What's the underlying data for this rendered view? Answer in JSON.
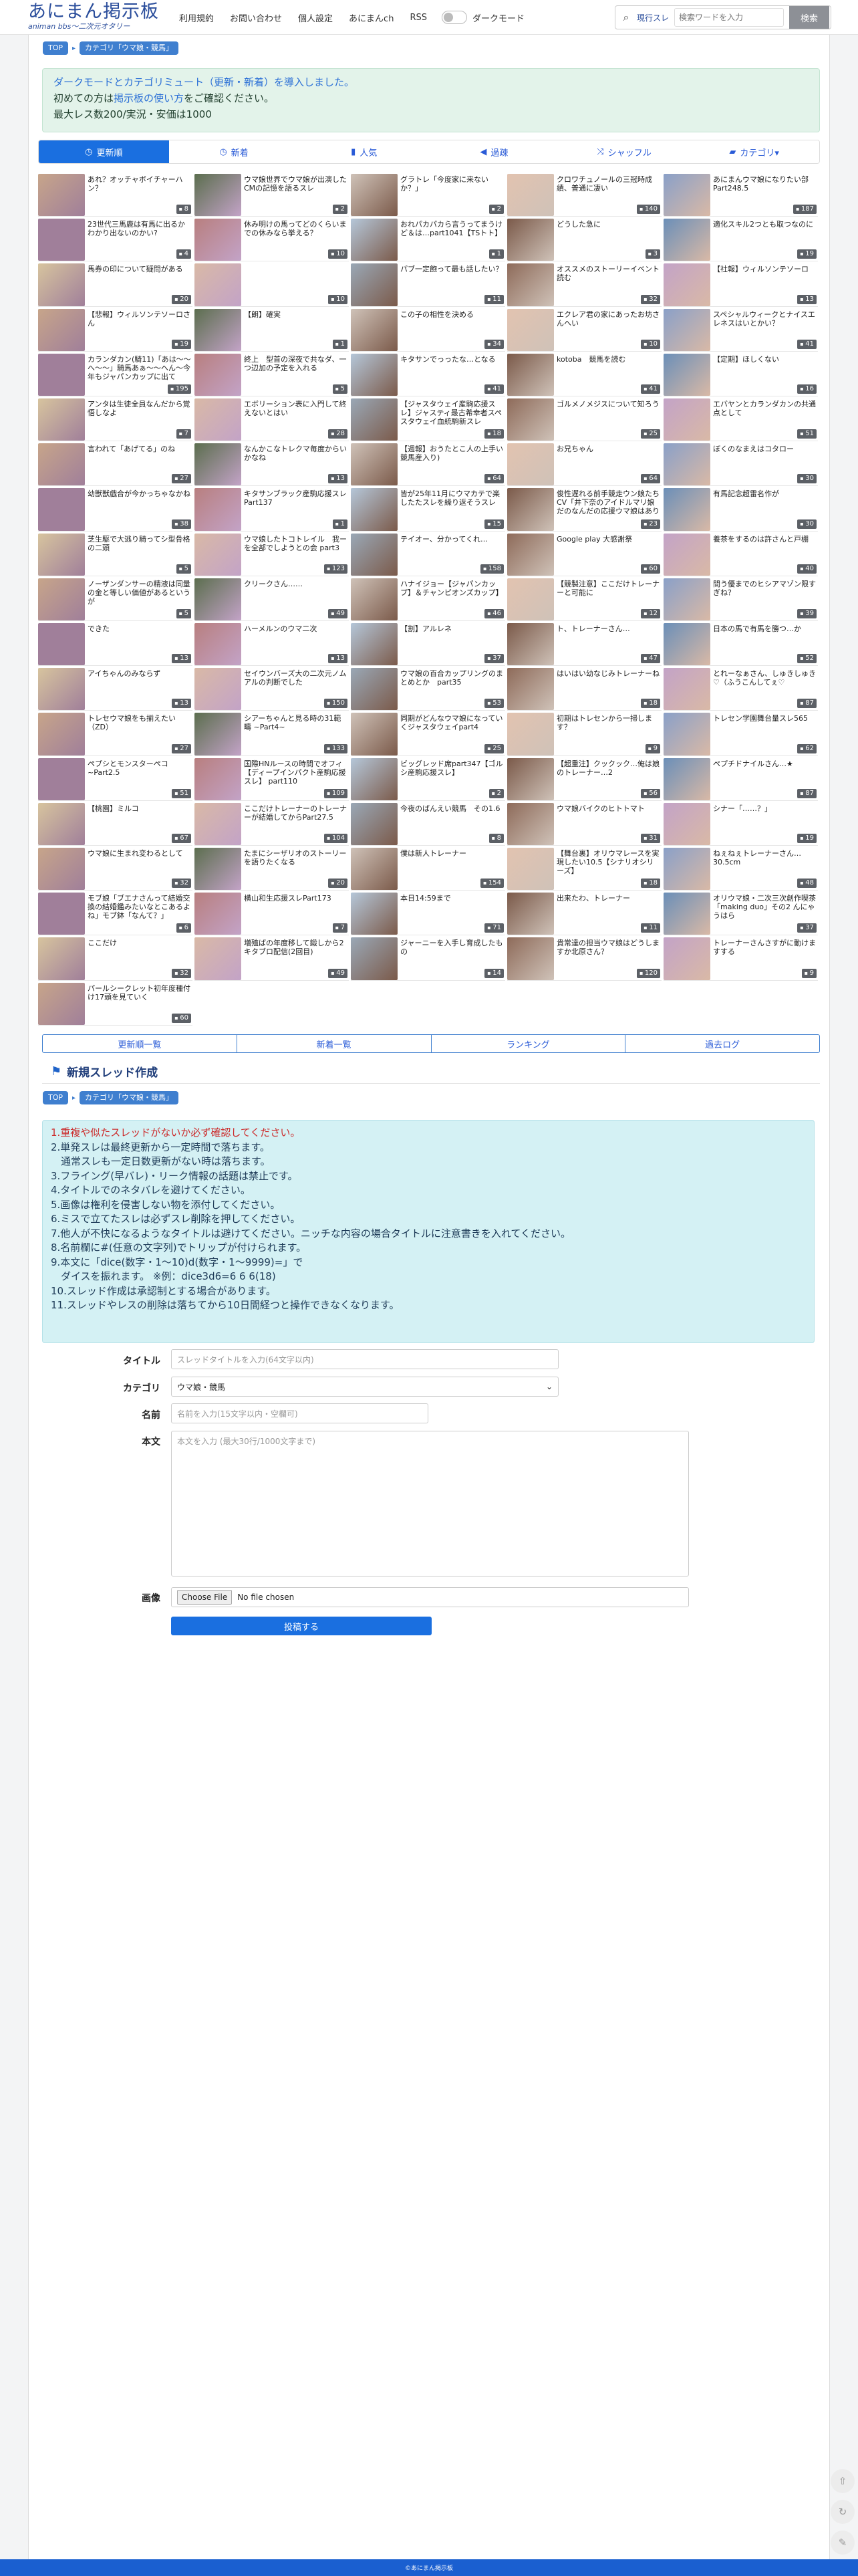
{
  "header": {
    "logo_title": "あにまん掲示板",
    "logo_subtitle": "animan bbs〜二次元オタリー",
    "nav": [
      "利用規約",
      "お問い合わせ",
      "個人設定",
      "あにまんch",
      "RSS"
    ],
    "dark_mode_label": "ダークモード",
    "search_scope": "現行スレ",
    "search_placeholder": "検索ワードを入力",
    "search_button": "検索"
  },
  "breadcrumb": [
    "TOP",
    "カテゴリ「ウマ娘・競馬」"
  ],
  "notice": {
    "line1": "ダークモードとカテゴリミュート（更新・新着）を導入しました。",
    "line2_pre": "初めての方は",
    "line2_link": "掲示板の使い方",
    "line2_post": "をご確認ください。",
    "line3": "最大レス数200/実況・安価は1000"
  },
  "tabs": [
    "更新順",
    "新着",
    "人気",
    "過疎",
    "シャッフル",
    "カテゴリ▾"
  ],
  "tab_icons": [
    "clock-icon",
    "clock-icon",
    "bar-chart-icon",
    "speaker-icon",
    "shuffle-icon",
    "folder-icon"
  ],
  "threads": [
    {
      "title": "あれ？オッチャボイチャーハン？",
      "count": "8"
    },
    {
      "title": "ウマ娘世界でウマ娘が出演したCMの記憶を語るスレ",
      "count": "2"
    },
    {
      "title": "グラトレ「今度家に来ないか？」",
      "count": "2"
    },
    {
      "title": "クロワチュノールの三冠時成績、普通に凄い",
      "count": "140"
    },
    {
      "title": "あにまんウマ娘になりたい部Part248.5",
      "count": "187"
    },
    {
      "title": "23世代三馬鹿は有馬に出るかわかり出ないのかい?",
      "count": "4"
    },
    {
      "title": "休み明けの馬ってどのくらいまでの休みなら挙える？",
      "count": "10"
    },
    {
      "title": "おれパカパカら言うってまうけど＆は…part1041【TSトト】",
      "count": "1"
    },
    {
      "title": "どうした急に",
      "count": "3"
    },
    {
      "title": "適化スキル2つとも取つなのに",
      "count": "19"
    },
    {
      "title": "馬券の印について疑問がある",
      "count": "20"
    },
    {
      "title": "",
      "count": "10"
    },
    {
      "title": "パブ一定飽って最も話したい？",
      "count": "11"
    },
    {
      "title": "オススメのストーリーイベント読む",
      "count": "32"
    },
    {
      "title": "【社報】ウィルソンテソーロ",
      "count": "13"
    },
    {
      "title": "【悲報】ウィルソンテソーロさん",
      "count": "19"
    },
    {
      "title": "【朗】確実",
      "count": "1"
    },
    {
      "title": "この子の相性を決める",
      "count": "34"
    },
    {
      "title": "エクレア君の家にあったお坊さんへい",
      "count": "10"
    },
    {
      "title": "スペシャルウィークとナイスエレネスはいとかい？",
      "count": "41"
    },
    {
      "title": "カランダカン(騎11)「あは〜〜へ〜〜」騎馬あぁ〜〜へん〜今年もジャパンカップに出てぇ〜〜へ",
      "count": "195"
    },
    {
      "title": "終上　型首の深夜で共なダ、一つ辺加の予定を入れる",
      "count": "5"
    },
    {
      "title": "キタサンでっったな…となる",
      "count": "41"
    },
    {
      "title": "kotoba　競馬を読む",
      "count": "41"
    },
    {
      "title": "【定期】ほしくない",
      "count": "16"
    },
    {
      "title": "アンタは生徒全員なんだから覚悟しなよ",
      "count": "7"
    },
    {
      "title": "エボリーション表に入門して終えないとはい",
      "count": "28"
    },
    {
      "title": "【ジャスタウェイ産駒応援スレ】ジャスティ最古希幸者スペスタウェイ血統駒新スレ",
      "count": "18"
    },
    {
      "title": "ゴルメノメジスについて知ろう",
      "count": "25"
    },
    {
      "title": "エバヤンとカランダカンの共通点として",
      "count": "51"
    },
    {
      "title": "言われて「あげてる」のね",
      "count": "27"
    },
    {
      "title": "なんかこなトレクマ毎度からいかなね",
      "count": "13"
    },
    {
      "title": "【週報】おうたとこ人の上手い競馬産入り)",
      "count": "64"
    },
    {
      "title": "お兄ちゃん",
      "count": "64"
    },
    {
      "title": "ぼくのなまえはコタロー",
      "count": "30"
    },
    {
      "title": "幼獣獣戯合が今かっちゃなかね",
      "count": "38"
    },
    {
      "title": "キタサンブラック産駒応援スレ Part137",
      "count": "1"
    },
    {
      "title": "皆が25年11月にウマカテで楽したたスレを繰り返そうスレ",
      "count": "15"
    },
    {
      "title": "俊性遅れる前手競走ウン娘たち　CV「井下奈のアイドルマリ娘だのなんだの応援ウマ娘はありかも見よう",
      "count": "23"
    },
    {
      "title": "有馬記念超雷名作が",
      "count": "30"
    },
    {
      "title": "芝生駆で大逃り騎ってシ型骨格の二頭",
      "count": "5"
    },
    {
      "title": "ウマ娘したトコトレイル　我ーを全部でしようとの会 part3",
      "count": "123"
    },
    {
      "title": "テイオー、分かってくれ…",
      "count": "158"
    },
    {
      "title": "Google play 大感謝祭",
      "count": "60"
    },
    {
      "title": "養茶をするのは許さんと戸棚",
      "count": "40"
    },
    {
      "title": "ノーザンダンサーの精液は同量の金と等しい価値があるというが",
      "count": "5"
    },
    {
      "title": "クリークさん……",
      "count": "49"
    },
    {
      "title": "ハナイジョー【ジャパンカップ】＆チャンピオンズカップ】",
      "count": "46"
    },
    {
      "title": "【競製注意】ここだけトレーナーと可能に",
      "count": "12"
    },
    {
      "title": "間う優までのヒシアマゾン限すぎね？",
      "count": "39"
    },
    {
      "title": "できた",
      "count": "13"
    },
    {
      "title": "ハーメルンのウマ二次",
      "count": "13"
    },
    {
      "title": "【割】アルレネ",
      "count": "37"
    },
    {
      "title": "ト、トレーナーさん…",
      "count": "47"
    },
    {
      "title": "日本の馬で有馬を勝つ…か",
      "count": "52"
    },
    {
      "title": "アイちゃんのみならず",
      "count": "13"
    },
    {
      "title": "セイウンバーズ大の二次元ノムアルの判断でした",
      "count": "150"
    },
    {
      "title": "ウマ娘の百合カップリングのまとめとか　part35",
      "count": "53"
    },
    {
      "title": "はいはい幼なじみトレーナーね",
      "count": "18"
    },
    {
      "title": "とれーなぁさん、しゅきしゅき♡（ふうこんしてぇ♡",
      "count": "87"
    },
    {
      "title": "トレセウマ娘をも揃えたい（ZD）",
      "count": "27"
    },
    {
      "title": "シアーちゃんと見る時の31範疇 ~Part4~",
      "count": "133"
    },
    {
      "title": "同期がどんなウマ娘になっていくジャスタウェイpart4",
      "count": "25"
    },
    {
      "title": "初期はトレセンから一掃します？",
      "count": "9"
    },
    {
      "title": "トレセン学園舞台量スレ565",
      "count": "62"
    },
    {
      "title": "ペプシとモンスターペコ~Part2.5",
      "count": "51"
    },
    {
      "title": "国際HNルースの時間でオフィ【ディープインパクト産駒応援スレ】 part110",
      "count": "109"
    },
    {
      "title": "ビッグレッド席part347【ゴルシ産駒応援スレ】",
      "count": "2"
    },
    {
      "title": "【超重注】クックック…俺は娘のトレーナー…2",
      "count": "56"
    },
    {
      "title": "ペプチドナイルさん…★",
      "count": "87"
    },
    {
      "title": "【桃園】ミルコ",
      "count": "67"
    },
    {
      "title": "ここだけトレーナーのトレーナーが結婚してからPart27.5",
      "count": "104"
    },
    {
      "title": "今夜のばんえい競馬　その1.6",
      "count": "8"
    },
    {
      "title": "ウマ娘バイクのヒトトマト",
      "count": "31"
    },
    {
      "title": "シナー「……？」",
      "count": "19"
    },
    {
      "title": "ウマ娘に生まれ変わるとして",
      "count": "32"
    },
    {
      "title": "たまにシーザリオのストーリーを語りたくなる",
      "count": "20"
    },
    {
      "title": "僕は新人トレーナー",
      "count": "154"
    },
    {
      "title": "【舞台裏】オリウマレースを実現したい10.5【シナリオシリーズ】",
      "count": "18"
    },
    {
      "title": "ねぇねぇトレーナーさん…30.5cm",
      "count": "48"
    },
    {
      "title": "モブ娘「ブエナさんって結婚交換の結婚鑑みたいなとこあるよね」モブ鉢「なんて？」",
      "count": "6"
    },
    {
      "title": "横山和生応援スレPart173",
      "count": "7"
    },
    {
      "title": "本日14:59まで",
      "count": "71"
    },
    {
      "title": "出来たわ、トレーナー",
      "count": "11"
    },
    {
      "title": "オリウマ娘・二次三次創作喫茶「making duo」その2 んにゃうはら",
      "count": "37"
    },
    {
      "title": "ここだけ",
      "count": "32"
    },
    {
      "title": "増殖ばの年度移して鍛しから2キタブロ配信(2回目)",
      "count": "49"
    },
    {
      "title": "ジャーニーを入手し育成したもの",
      "count": "14"
    },
    {
      "title": "貴常達の担当ウマ娘はどうしますか北原さん？",
      "count": "120"
    },
    {
      "title": "トレーナーさんさすがに動けますする",
      "count": "9"
    },
    {
      "title": "パールシークレット初年度種付け17頭を見ていく",
      "count": "60"
    }
  ],
  "bottom_tabs": [
    "更新順一覧",
    "新着一覧",
    "ランキング",
    "過去ログ"
  ],
  "new_thread": {
    "title": "新規スレッド作成",
    "rules": [
      "1.重複や似たスレッドがないか必ず確認してください。",
      "2.単発スレは最終更新から一定時間で落ちます。",
      "　通常スレも一定日数更新がない時は落ちます。",
      "3.フライング(早バレ)・リーク情報の話題は禁止です。",
      "4.タイトルでのネタバレを避けてください。",
      "5.画像は権利を侵害しない物を添付してください。",
      "6.ミスで立てたスレは必ずスレ削除を押してください。",
      "7.他人が不快になるようなタイトルは避けてください。ニッチな内容の場合タイトルに注意書きを入れてください。",
      "8.名前欄に#(任意の文字列)でトリップが付けられます。",
      "9.本文に「dice(数字・1〜10)d(数字・1〜9999)=」で",
      "　ダイスを振れます。 ※例：dice3d6=6 6 6(18)",
      "10.スレッド作成は承認制とする場合があります。",
      "11.スレッドやレスの削除は落ちてから10日間経つと操作できなくなります。"
    ],
    "labels": {
      "title": "タイトル",
      "category": "カテゴリ",
      "name": "名前",
      "body": "本文",
      "image": "画像"
    },
    "title_placeholder": "スレッドタイトルを入力(64文字以内)",
    "category_value": "ウマ娘・競馬",
    "name_placeholder": "名前を入力(15文字以内・空欄可)",
    "body_placeholder": "本文を入力 (最大30行/1000文字まで)",
    "file_button": "Choose File",
    "file_status": "No file chosen",
    "submit": "投稿する"
  },
  "footer": "©あにまん掲示板",
  "colors": {
    "accent": "#1a6fe0",
    "logo": "#2a4d9b",
    "notice_bg": "#e3f3ea",
    "rules_bg": "#d4f1f4",
    "footer": "#1a5fd0"
  }
}
